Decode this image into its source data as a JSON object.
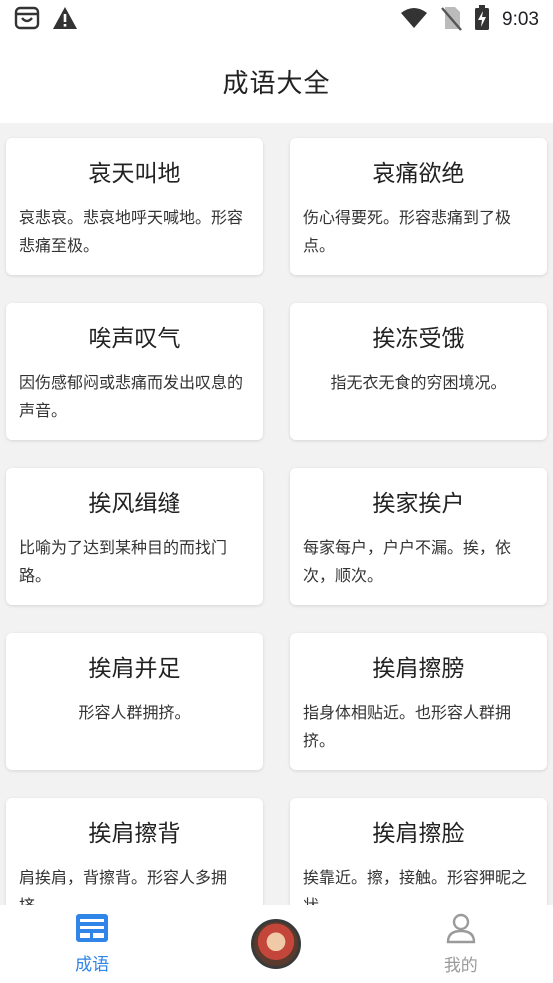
{
  "status_bar": {
    "time": "9:03"
  },
  "header": {
    "title": "成语大全"
  },
  "idioms": [
    {
      "title": "哀天叫地",
      "desc": "哀悲哀。悲哀地呼天喊地。形容悲痛至极。",
      "align": "left"
    },
    {
      "title": "哀痛欲绝",
      "desc": "伤心得要死。形容悲痛到了极点。",
      "align": "left"
    },
    {
      "title": "唉声叹气",
      "desc": "因伤感郁闷或悲痛而发出叹息的声音。",
      "align": "left"
    },
    {
      "title": "挨冻受饿",
      "desc": "指无衣无食的穷困境况。",
      "align": "center"
    },
    {
      "title": "挨风缉缝",
      "desc": "比喻为了达到某种目的而找门路。",
      "align": "left"
    },
    {
      "title": "挨家挨户",
      "desc": "每家每户，户户不漏。挨，依次，顺次。",
      "align": "left"
    },
    {
      "title": "挨肩并足",
      "desc": "形容人群拥挤。",
      "align": "center"
    },
    {
      "title": "挨肩擦膀",
      "desc": "指身体相贴近。也形容人群拥挤。",
      "align": "left"
    },
    {
      "title": "挨肩擦背",
      "desc": "肩挨肩，背擦背。形容人多拥挤。",
      "align": "left"
    },
    {
      "title": "挨肩擦脸",
      "desc": "挨靠近。擦，接触。形容狎昵之状。",
      "align": "left"
    }
  ],
  "bottom_nav": {
    "items": [
      {
        "label": "成语",
        "icon": "news-icon",
        "active": true
      },
      {
        "label": "",
        "icon": "avatar-icon",
        "active": false
      },
      {
        "label": "我的",
        "icon": "person-icon",
        "active": false
      }
    ]
  },
  "colors": {
    "accent": "#2f86e8",
    "inactive": "#9a9a9a",
    "background": "#f2f2f2",
    "card": "#ffffff"
  }
}
